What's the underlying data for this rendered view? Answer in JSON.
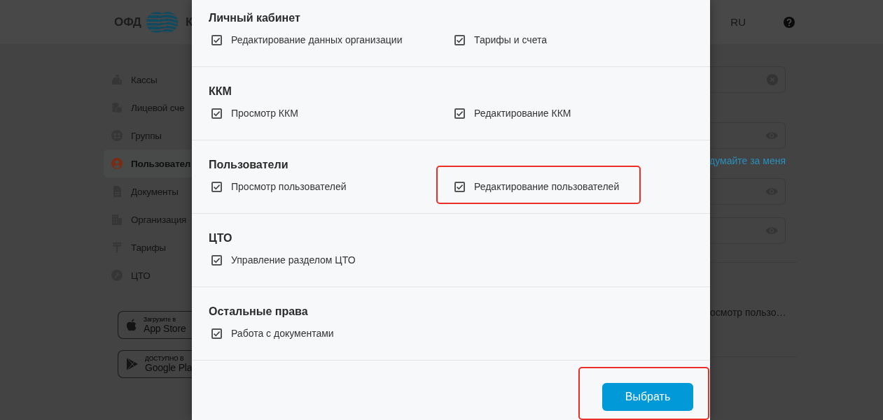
{
  "header": {
    "logo_text": "ОФД",
    "brand_fragment": "К",
    "language": "RU"
  },
  "sidebar": {
    "items": [
      {
        "label": "Кассы",
        "selected": false
      },
      {
        "label": "Лицевой сче",
        "selected": false
      },
      {
        "label": "Группы",
        "selected": false
      },
      {
        "label": "Пользовател",
        "selected": true
      },
      {
        "label": "Документы",
        "selected": false
      },
      {
        "label": "Организация",
        "selected": false
      },
      {
        "label": "Тарифы",
        "selected": false
      },
      {
        "label": "ЦТО",
        "selected": false
      }
    ]
  },
  "app_badges": [
    {
      "caption": "Загрузите в",
      "name": "App Store"
    },
    {
      "caption": "ДОСТУПНО В",
      "name": "Google Pla"
    }
  ],
  "form": {
    "fields": [
      {
        "kind": "clearable"
      },
      {
        "kind": "password",
        "link": "думайте за меня"
      },
      {
        "kind": "password"
      },
      {
        "kind": "password"
      }
    ],
    "permissions_summary": "осмотр пользо…"
  },
  "dialog": {
    "sections": [
      {
        "title": "Личный кабинет",
        "items": [
          {
            "label": "Редактирование данных организации",
            "checked": true,
            "highlighted": false
          },
          {
            "label": "Тарифы и счета",
            "checked": true,
            "highlighted": false
          }
        ]
      },
      {
        "title": "ККМ",
        "items": [
          {
            "label": "Просмотр ККМ",
            "checked": true,
            "highlighted": false
          },
          {
            "label": "Редактирование ККМ",
            "checked": true,
            "highlighted": false
          }
        ]
      },
      {
        "title": "Пользователи",
        "items": [
          {
            "label": "Просмотр пользователей",
            "checked": true,
            "highlighted": false
          },
          {
            "label": "Редактирование пользователей",
            "checked": true,
            "highlighted": true
          }
        ]
      },
      {
        "title": "ЦТО",
        "items": [
          {
            "label": "Управление разделом ЦТО",
            "checked": true,
            "highlighted": false
          }
        ]
      },
      {
        "title": "Остальные права",
        "items": [
          {
            "label": "Работа с документами",
            "checked": true,
            "highlighted": false
          }
        ]
      }
    ],
    "submit_button": {
      "label": "Выбрать",
      "highlighted": true
    }
  }
}
